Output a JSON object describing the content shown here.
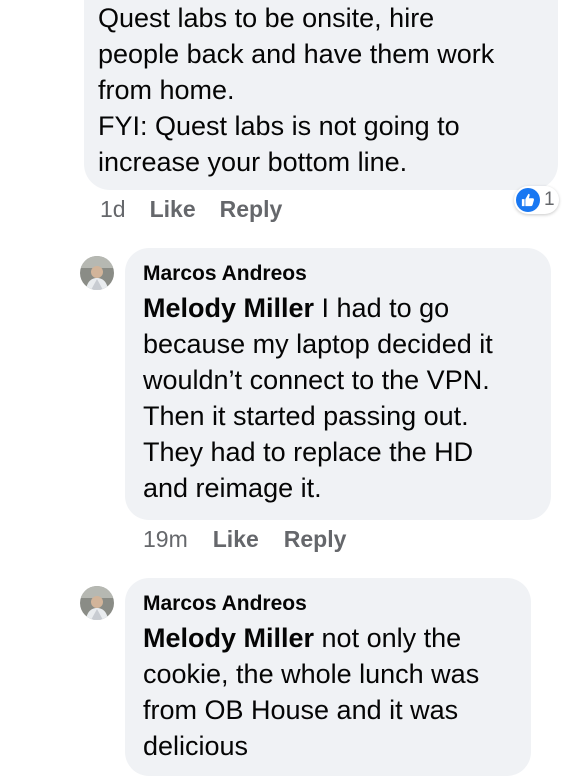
{
  "comment_top": {
    "lines": [
      "Quest labs to be onsite, hire",
      "people back and have them work",
      "from home.",
      "FYI: Quest labs is not going to",
      "increase your bottom line."
    ],
    "time": "1d",
    "like_label": "Like",
    "reply_label": "Reply",
    "reaction_icon": "thumbs-up-icon",
    "reaction_count": "1"
  },
  "reply_1": {
    "author": "Marcos Andreos",
    "mention": "Melody Miller",
    "first_line_text": " I had to go",
    "lines": [
      "because my laptop decided it",
      "wouldn’t connect to the VPN.",
      "Then it started passing out.",
      "They had to replace the HD",
      "and reimage it."
    ],
    "time": "19m",
    "like_label": "Like",
    "reply_label": "Reply"
  },
  "reply_2": {
    "author": "Marcos Andreos",
    "mention": "Melody Miller",
    "first_line_text": " not only the",
    "lines": [
      "cookie, the whole lunch was",
      "from OB House and it was",
      "delicious"
    ]
  },
  "colors": {
    "bubble": "#f0f2f5",
    "secondary_text": "#65676b",
    "like_blue": "#1877f2"
  }
}
